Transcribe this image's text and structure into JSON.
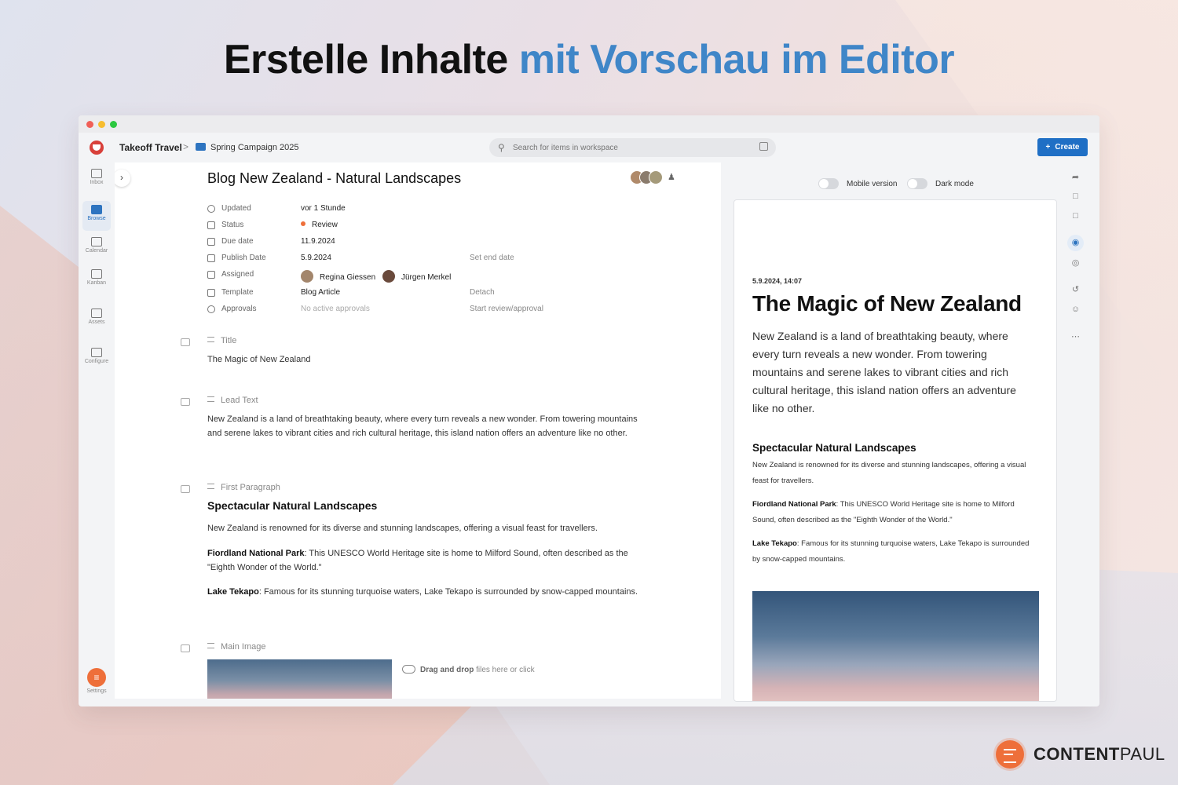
{
  "headline": {
    "part1": "Erstelle Inhalte",
    "part2": "mit Vorschau im Editor"
  },
  "colors": {
    "accent": "#3f86c8",
    "primary_button": "#1f6fc5",
    "status_review": "#ee6f3a",
    "brand": "#ee6f3a"
  },
  "breadcrumb": {
    "workspace": "Takeoff Travel",
    "separator": ">",
    "campaign": "Spring Campaign 2025"
  },
  "search": {
    "placeholder": "Search for items in workspace"
  },
  "create_button": {
    "icon": "plus-icon",
    "label": "Create"
  },
  "sidebar": {
    "items": [
      {
        "label": "Inbox",
        "icon": "inbox-icon",
        "active": false
      },
      {
        "label": "Browse",
        "icon": "folder-icon",
        "active": true
      },
      {
        "label": "Calendar",
        "icon": "calendar-icon",
        "active": false
      },
      {
        "label": "Kanban",
        "icon": "kanban-icon",
        "active": false
      },
      {
        "label": "Assets",
        "icon": "assets-icon",
        "active": false
      },
      {
        "label": "Configure",
        "icon": "configure-icon",
        "active": false
      }
    ],
    "settings_label": "Settings"
  },
  "document": {
    "title": "Blog New Zealand - Natural Landscapes",
    "meta": {
      "updated": {
        "label": "Updated",
        "value": "vor 1 Stunde"
      },
      "status": {
        "label": "Status",
        "value": "Review"
      },
      "due_date": {
        "label": "Due date",
        "value": "11.9.2024"
      },
      "publish_date": {
        "label": "Publish Date",
        "value": "5.9.2024",
        "extra": "Set end date"
      },
      "assigned": {
        "label": "Assigned",
        "people": [
          "Regina Giessen",
          "Jürgen Merkel"
        ]
      },
      "template": {
        "label": "Template",
        "value": "Blog Article",
        "extra": "Detach"
      },
      "approvals": {
        "label": "Approvals",
        "value": "No active approvals",
        "extra": "Start review/approval"
      }
    },
    "fields": {
      "title": {
        "label": "Title",
        "value": "The Magic of New Zealand"
      },
      "lead": {
        "label": "Lead Text",
        "value": "New Zealand is a land of breathtaking beauty, where every turn reveals a new wonder. From towering mountains and serene lakes to vibrant cities and rich cultural heritage, this island nation offers an adventure like no other."
      },
      "first_paragraph": {
        "label": "First Paragraph",
        "heading": "Spectacular Natural Landscapes",
        "intro": "New Zealand is renowned for its diverse and stunning landscapes, offering a visual feast for travellers.",
        "item1_name": "Fiordland National Park",
        "item1_text": ": This UNESCO World Heritage site is home to Milford Sound, often described as the \"Eighth Wonder of the World.\"",
        "item2_name": "Lake Tekapo",
        "item2_text": ": Famous for its stunning turquoise waters, Lake Tekapo is surrounded by snow-capped mountains."
      },
      "main_image": {
        "label": "Main Image",
        "drop_strong": "Drag and drop",
        "drop_rest": "files here or click"
      }
    }
  },
  "preview": {
    "mobile_label": "Mobile version",
    "dark_label": "Dark mode",
    "date": "5.9.2024, 14:07",
    "title": "The Magic of New Zealand",
    "lead": "New Zealand is a land of breathtaking beauty, where every turn reveals a new wonder. From towering mountains and serene lakes to vibrant cities and rich cultural heritage, this island nation offers an adventure like no other.",
    "heading": "Spectacular Natural Landscapes",
    "p1": "New Zealand is renowned for its diverse and stunning landscapes, offering a visual feast for travellers.",
    "p2_name": "Fiordland National Park",
    "p2_text": ": This UNESCO World Heritage site is home to Milford Sound, often described as the \"Eighth Wonder of the World.\"",
    "p3_name": "Lake Tekapo",
    "p3_text": ": Famous for its stunning turquoise waters, Lake Tekapo is surrounded by snow-capped mountains."
  },
  "brand": {
    "name_bold": "CONTENT",
    "name_rest": "PAUL"
  }
}
